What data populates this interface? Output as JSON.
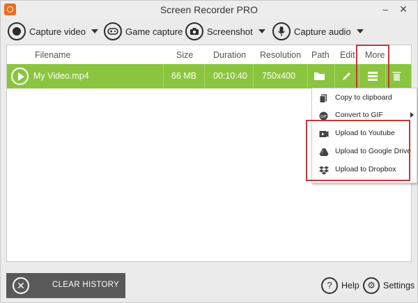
{
  "window": {
    "title": "Screen Recorder PRO",
    "minimize_label": "–",
    "close_label": "✕"
  },
  "toolbar": {
    "capture_video": "Capture video",
    "game_capture": "Game capture",
    "screenshot": "Screenshot",
    "capture_audio": "Capture audio"
  },
  "table": {
    "headers": {
      "filename": "Filename",
      "size": "Size",
      "duration": "Duration",
      "resolution": "Resolution",
      "path": "Path",
      "edit": "Edit",
      "more": "More"
    },
    "rows": [
      {
        "filename": "My Video.mp4",
        "size": "66 MB",
        "duration": "00:10:40",
        "resolution": "750x400"
      }
    ]
  },
  "more_menu": {
    "items": [
      {
        "label": "Copy to clipboard",
        "icon": "clipboard-icon"
      },
      {
        "label": "Convert to GIF",
        "icon": "gif-icon",
        "has_submenu": true
      },
      {
        "label": "Upload to Youtube",
        "icon": "youtube-icon"
      },
      {
        "label": "Upload to Google Drive",
        "icon": "google-drive-icon"
      },
      {
        "label": "Upload to Dropbox",
        "icon": "dropbox-icon"
      }
    ]
  },
  "footer": {
    "clear_history": "CLEAR HISTORY",
    "help": "Help",
    "settings": "Settings"
  },
  "colors": {
    "row_selected": "#8bc53f",
    "highlight": "#c0393b",
    "clear_button": "#595959",
    "logo": "#ee6a1f"
  }
}
